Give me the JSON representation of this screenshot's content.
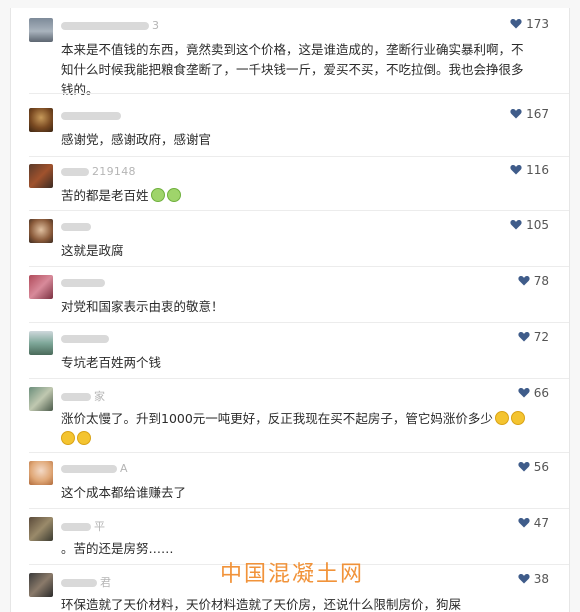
{
  "colors": {
    "heart": "#3f5c8a",
    "watermark": "#f08a2a"
  },
  "comments": [
    {
      "name": "3",
      "likes": "173",
      "text": "本来是不值钱的东西，竟然卖到这个价格，这是谁造成的，垄断行业确实暴利啊，不知什么时候我能把粮食垄断了，一千块钱一斤，爱买不买，不吃拉倒。我也会挣很多钱的。"
    },
    {
      "name": "",
      "likes": "167",
      "text": "感谢党，感谢政府，感谢官"
    },
    {
      "name": "219148",
      "likes": "116",
      "text": "苦的都是老百姓"
    },
    {
      "name": "",
      "likes": "105",
      "text": "这就是政腐"
    },
    {
      "name": "",
      "likes": "78",
      "text": "对党和国家表示由衷的敬意！"
    },
    {
      "name": "",
      "likes": "72",
      "text": "专坑老百姓两个钱"
    },
    {
      "name": "家",
      "likes": "66",
      "text": "涨价太慢了。升到1000元一吨更好，反正我现在买不起房子，管它妈涨价多少"
    },
    {
      "name": "A",
      "likes": "56",
      "text": "这个成本都给谁赚去了"
    },
    {
      "name": "平",
      "likes": "47",
      "text": "。苦的还是房努……"
    },
    {
      "name": "君",
      "likes": "38",
      "text": "环保造就了天价材料，天价材料造就了天价房，还说什么限制房价，狗屎"
    }
  ],
  "watermark": "中国混凝土网"
}
